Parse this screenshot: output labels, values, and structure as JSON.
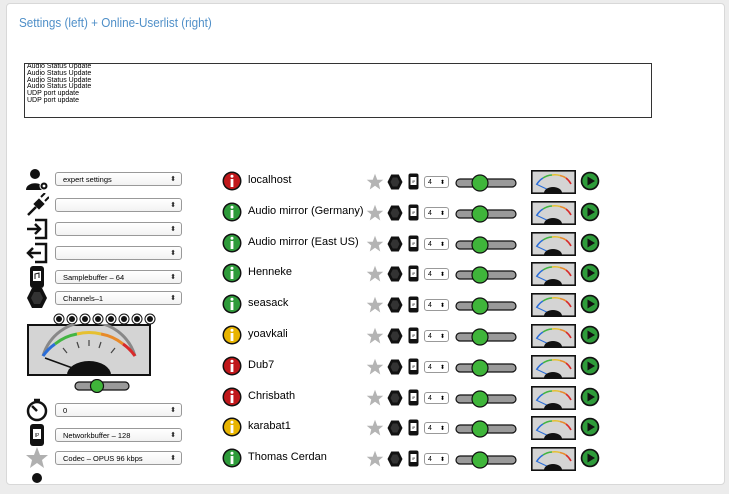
{
  "title": "Settings (left) + Online-Userlist (right)",
  "log": [
    "Audio Status Update",
    "Audio Status Update",
    "Audio Status Update",
    "Audio Status Update",
    "UDP port update",
    "UDP port update"
  ],
  "settings": [
    {
      "icon": "user-settings-icon",
      "value": "expert settings"
    },
    {
      "icon": "microphone-plug-icon",
      "value": ""
    },
    {
      "icon": "audio-input-icon",
      "value": ""
    },
    {
      "icon": "audio-output-icon",
      "value": ""
    },
    {
      "icon": "sample-buffer-icon",
      "value": "Samplebuffer – 64"
    },
    {
      "icon": "channels-hex-icon",
      "value": "Channels–1"
    }
  ],
  "lower_settings": [
    {
      "icon": "timer-icon",
      "value": "0"
    },
    {
      "icon": "network-buffer-icon",
      "value": "Networkbuffer – 128"
    },
    {
      "icon": "codec-star-icon",
      "value": "Codec – OPUS 96 kbps"
    }
  ],
  "colors": {
    "green": "#2e9b3a",
    "red": "#c0181b",
    "yellow": "#e8b400",
    "accent": "#4f8fc8",
    "slider_knob": "#3fb53a"
  },
  "users": [
    {
      "name": "localhost",
      "status": "red",
      "buffer": "4"
    },
    {
      "name": "Audio mirror (Germany)",
      "status": "green",
      "buffer": "4"
    },
    {
      "name": "Audio mirror (East US)",
      "status": "green",
      "buffer": "4"
    },
    {
      "name": "Henneke",
      "status": "green",
      "buffer": "4"
    },
    {
      "name": "seasack",
      "status": "green",
      "buffer": "4"
    },
    {
      "name": "yoavkali",
      "status": "yellow",
      "buffer": "4"
    },
    {
      "name": "Dub7",
      "status": "red",
      "buffer": "4"
    },
    {
      "name": "Chrisbath",
      "status": "red",
      "buffer": "4"
    },
    {
      "name": "karabat1",
      "status": "yellow",
      "buffer": "4"
    },
    {
      "name": "Thomas Cerdan",
      "status": "green",
      "buffer": "4"
    }
  ]
}
